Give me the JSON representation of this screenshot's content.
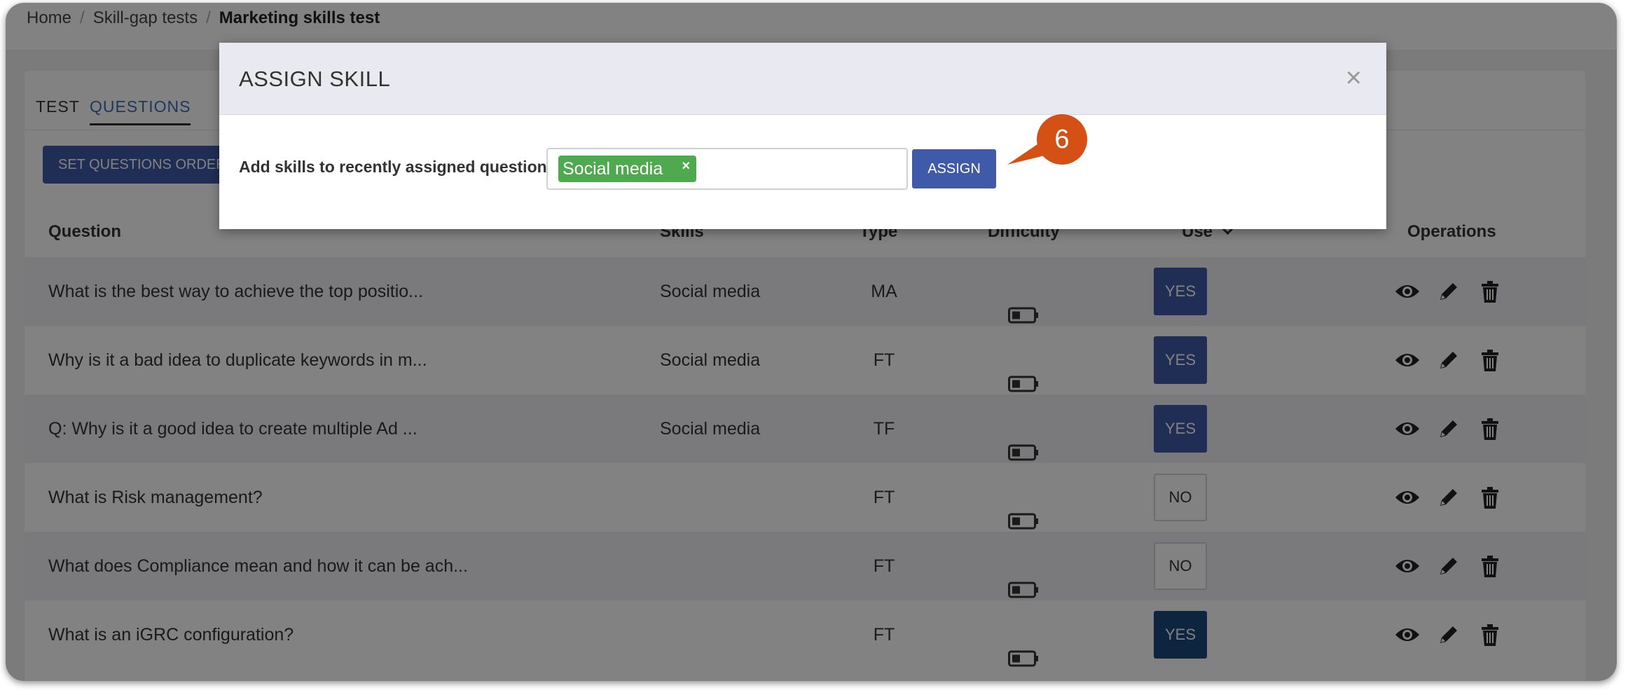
{
  "breadcrumb": {
    "home": "Home",
    "section": "Skill-gap tests",
    "current": "Marketing skills test"
  },
  "tabs": [
    {
      "label": "TEST"
    },
    {
      "label": "QUESTIONS"
    }
  ],
  "set_order_button": "SET QUESTIONS ORDER",
  "table": {
    "headers": {
      "question": "Question",
      "skills": "Skills",
      "type": "Type",
      "difficulty": "Difficulty",
      "use": "Use",
      "operations": "Operations"
    },
    "rows": [
      {
        "question": "What is the best way to achieve the top positio...",
        "skills": "Social media",
        "type": "MA",
        "use": "YES"
      },
      {
        "question": "Why is it a bad idea to duplicate keywords in m...",
        "skills": "Social media",
        "type": "FT",
        "use": "YES"
      },
      {
        "question": "Q: Why is it a good idea to create multiple Ad ...",
        "skills": "Social media",
        "type": "TF",
        "use": "YES"
      },
      {
        "question": "What is Risk management?",
        "skills": "",
        "type": "FT",
        "use": "NO"
      },
      {
        "question": "What does Compliance mean and how it can be ach...",
        "skills": "",
        "type": "FT",
        "use": "NO"
      },
      {
        "question": "What is an iGRC configuration?",
        "skills": "",
        "type": "FT",
        "use": "YES"
      }
    ]
  },
  "modal": {
    "title": "ASSIGN SKILL",
    "close": "×",
    "label": "Add skills to recently assigned question",
    "tag": "Social media",
    "tag_remove": "×",
    "assign_button": "ASSIGN"
  },
  "callout": {
    "number": "6",
    "color": "#d55015"
  },
  "colors": {
    "primary": "#3f5aa8",
    "tag_green": "#4fa94f",
    "use_dark": "#1b4a7a"
  }
}
